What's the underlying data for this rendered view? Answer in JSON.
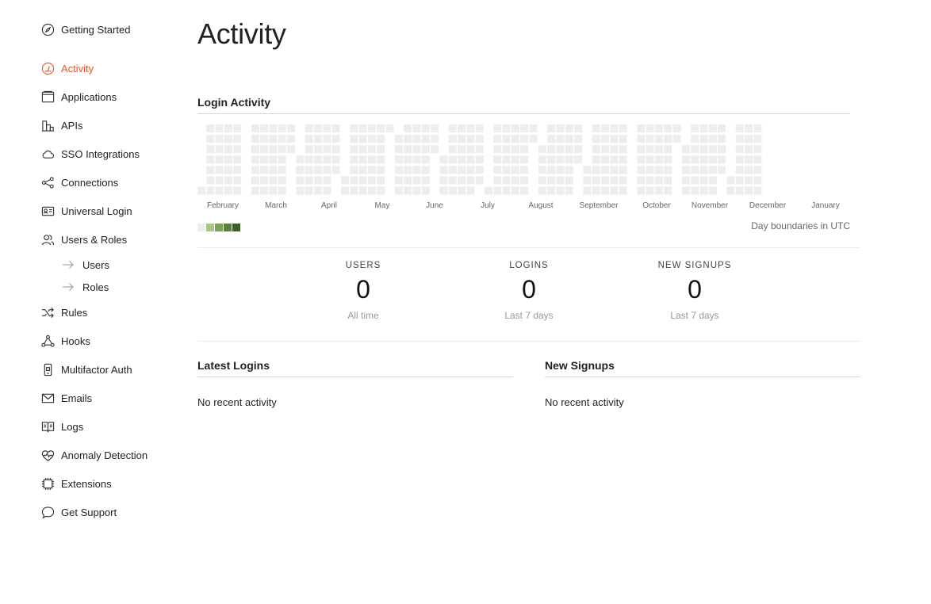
{
  "sidebar": {
    "items": [
      {
        "label": "Getting Started",
        "icon": "compass-icon",
        "active": false
      },
      {
        "label": "Activity",
        "icon": "gauge-icon",
        "active": true
      },
      {
        "label": "Applications",
        "icon": "window-icon",
        "active": false
      },
      {
        "label": "APIs",
        "icon": "building-icon",
        "active": false
      },
      {
        "label": "SSO Integrations",
        "icon": "cloud-icon",
        "active": false
      },
      {
        "label": "Connections",
        "icon": "share-nodes-icon",
        "active": false
      },
      {
        "label": "Universal Login",
        "icon": "id-card-icon",
        "active": false
      },
      {
        "label": "Users & Roles",
        "icon": "users-icon",
        "active": false
      },
      {
        "label": "Rules",
        "icon": "shuffle-icon",
        "active": false
      },
      {
        "label": "Hooks",
        "icon": "hooks-icon",
        "active": false
      },
      {
        "label": "Multifactor Auth",
        "icon": "phone-icon",
        "active": false
      },
      {
        "label": "Emails",
        "icon": "envelope-icon",
        "active": false
      },
      {
        "label": "Logs",
        "icon": "book-icon",
        "active": false
      },
      {
        "label": "Anomaly Detection",
        "icon": "heart-pulse-icon",
        "active": false
      },
      {
        "label": "Extensions",
        "icon": "chip-icon",
        "active": false
      },
      {
        "label": "Get Support",
        "icon": "speech-bubble-icon",
        "active": false
      }
    ],
    "sub_items": [
      {
        "label": "Users",
        "icon": "arrow-right-icon"
      },
      {
        "label": "Roles",
        "icon": "arrow-right-icon"
      }
    ]
  },
  "main": {
    "title": "Activity",
    "login_activity": {
      "title": "Login Activity",
      "months": [
        "February",
        "March",
        "April",
        "May",
        "June",
        "July",
        "August",
        "September",
        "October",
        "November",
        "December",
        "January"
      ],
      "utc_note": "Day boundaries in UTC",
      "legend_colors": [
        "#eeeeee",
        "#a6c97f",
        "#7ca35a",
        "#5b8040",
        "#3f5f2b"
      ],
      "empty_color": "#ededed"
    },
    "stats": [
      {
        "name": "USERS",
        "value": "0",
        "sub": "All time"
      },
      {
        "name": "LOGINS",
        "value": "0",
        "sub": "Last 7 days"
      },
      {
        "name": "NEW SIGNUPS",
        "value": "0",
        "sub": "Last 7 days"
      }
    ],
    "latest_logins": {
      "title": "Latest Logins",
      "empty": "No recent activity"
    },
    "new_signups": {
      "title": "New Signups",
      "empty": "No recent activity"
    }
  },
  "colors": {
    "accent": "#eb5424",
    "text": "#222222",
    "muted": "#999999"
  }
}
